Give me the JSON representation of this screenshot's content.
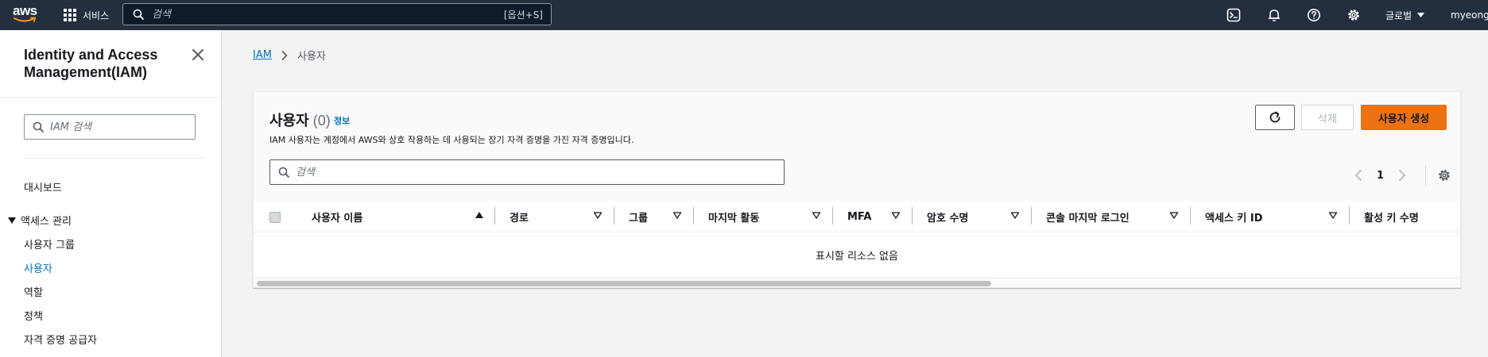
{
  "topnav": {
    "logo_text": "aws",
    "services_label": "서비스",
    "search_placeholder": "검색",
    "search_shortcut": "[옵션+S]",
    "region_label": "글로벌",
    "account_label": "myeongs"
  },
  "sidebar": {
    "title": "Identity and Access Management(IAM)",
    "search_placeholder": "IAM 검색",
    "dashboard": "대시보드",
    "section_access": "액세스 관리",
    "items": [
      {
        "label": "사용자 그룹"
      },
      {
        "label": "사용자"
      },
      {
        "label": "역할"
      },
      {
        "label": "정책"
      },
      {
        "label": "자격 증명 공급자"
      }
    ]
  },
  "breadcrumb": {
    "root": "IAM",
    "current": "사용자"
  },
  "panel": {
    "title": "사용자",
    "count": "(0)",
    "info_link": "정보",
    "description": "IAM 사용자는 계정에서 AWS와 상호 작용하는 데 사용되는 장기 자격 증명을 가진 자격 증명입니다.",
    "delete_label": "삭제",
    "create_label": "사용자 생성",
    "search_placeholder": "검색",
    "page_number": "1"
  },
  "table": {
    "columns": [
      {
        "label": "사용자 이름"
      },
      {
        "label": "경로"
      },
      {
        "label": "그룹"
      },
      {
        "label": "마지막 활동"
      },
      {
        "label": "MFA"
      },
      {
        "label": "암호 수명"
      },
      {
        "label": "콘솔 마지막 로그인"
      },
      {
        "label": "액세스 키 ID"
      },
      {
        "label": "활성 키 수명"
      }
    ],
    "empty_message": "표시할 리소스 없음"
  },
  "colors": {
    "topnav_bg": "#232f3e",
    "primary_button": "#ec7211",
    "link": "#0073bb"
  }
}
